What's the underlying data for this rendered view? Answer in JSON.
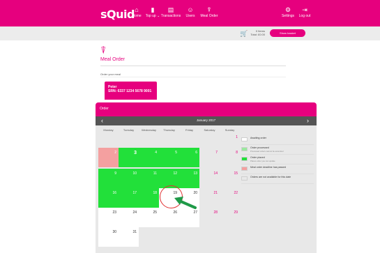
{
  "nav": {
    "logo": "sQuid",
    "items": [
      {
        "label": "Home",
        "icon": "home-icon",
        "glyph": "⌂"
      },
      {
        "label": "Top up ⌄",
        "icon": "bar-chart-icon",
        "glyph": "▮"
      },
      {
        "label": "Transactions",
        "icon": "receipt-icon",
        "glyph": "▤"
      },
      {
        "label": "Users",
        "icon": "users-icon",
        "glyph": "☺"
      },
      {
        "label": "Meal Order",
        "icon": "meal-icon",
        "glyph": "⍒"
      }
    ],
    "right": [
      {
        "label": "Settings",
        "icon": "gear-icon",
        "glyph": "⚙"
      },
      {
        "label": "Log out",
        "icon": "logout-icon",
        "glyph": "⇥"
      }
    ]
  },
  "basket": {
    "items": "0 Items",
    "total": "Total: £0.00",
    "button": "Show basket"
  },
  "page": {
    "title": "Meal Order",
    "intro": "Order your meal"
  },
  "child": {
    "name": "Peter",
    "srn": "SRN: 6337 1234 5678 9001"
  },
  "order": {
    "title": "Order",
    "month": "January 2017",
    "days": [
      "Monday",
      "Tuesday",
      "Wednesday",
      "Thursday",
      "Friday",
      "Saturday",
      "Sunday"
    ],
    "weeks": [
      [
        null,
        null,
        null,
        null,
        null,
        {
          "d": "",
          "s": "grey"
        },
        {
          "d": "1",
          "s": "grey"
        }
      ],
      [
        {
          "d": "2",
          "s": "pink"
        },
        {
          "d": "3",
          "s": "green"
        },
        {
          "d": "4",
          "s": "green"
        },
        {
          "d": "5",
          "s": "green"
        },
        {
          "d": "6",
          "s": "green"
        },
        {
          "d": "7",
          "s": "grey"
        },
        {
          "d": "8",
          "s": "grey"
        }
      ],
      [
        {
          "d": "9",
          "s": "green"
        },
        {
          "d": "10",
          "s": "green"
        },
        {
          "d": "11",
          "s": "green"
        },
        {
          "d": "12",
          "s": "green"
        },
        {
          "d": "13",
          "s": "green"
        },
        {
          "d": "14",
          "s": "grey"
        },
        {
          "d": "15",
          "s": "grey"
        }
      ],
      [
        {
          "d": "16",
          "s": "green"
        },
        {
          "d": "17",
          "s": "green"
        },
        {
          "d": "18",
          "s": "green"
        },
        {
          "d": "19",
          "s": "white"
        },
        {
          "d": "20",
          "s": "white"
        },
        {
          "d": "21",
          "s": "grey"
        },
        {
          "d": "22",
          "s": "grey"
        }
      ],
      [
        {
          "d": "23",
          "s": "white"
        },
        {
          "d": "24",
          "s": "white"
        },
        {
          "d": "25",
          "s": "white"
        },
        {
          "d": "26",
          "s": "white"
        },
        {
          "d": "27",
          "s": "white"
        },
        {
          "d": "28",
          "s": "grey"
        },
        {
          "d": "29",
          "s": "grey"
        }
      ],
      [
        {
          "d": "30",
          "s": "white"
        },
        {
          "d": "31",
          "s": "white"
        },
        null,
        null,
        null,
        null,
        null
      ]
    ],
    "legend": [
      {
        "label": "Awaiting order",
        "sub": "",
        "color": "#ffffff"
      },
      {
        "label": "Order processed",
        "sub": "Processed orders cannot be amended",
        "color": "#9be89f"
      },
      {
        "label": "Order placed",
        "sub": "Places order you can update",
        "color": "#22e03a"
      },
      {
        "label": "Meal order deadline has passed",
        "sub": "",
        "color": "#f4a0a0"
      },
      {
        "label": "Orders are not available for this date",
        "sub": "",
        "color": "#e8e8e8"
      }
    ]
  },
  "colors": {
    "brand": "#e6007e",
    "placed": "#22e03a",
    "deadline": "#f4a0a0",
    "highlight_ring": "#e03030",
    "arrow": "#1f9a48"
  }
}
